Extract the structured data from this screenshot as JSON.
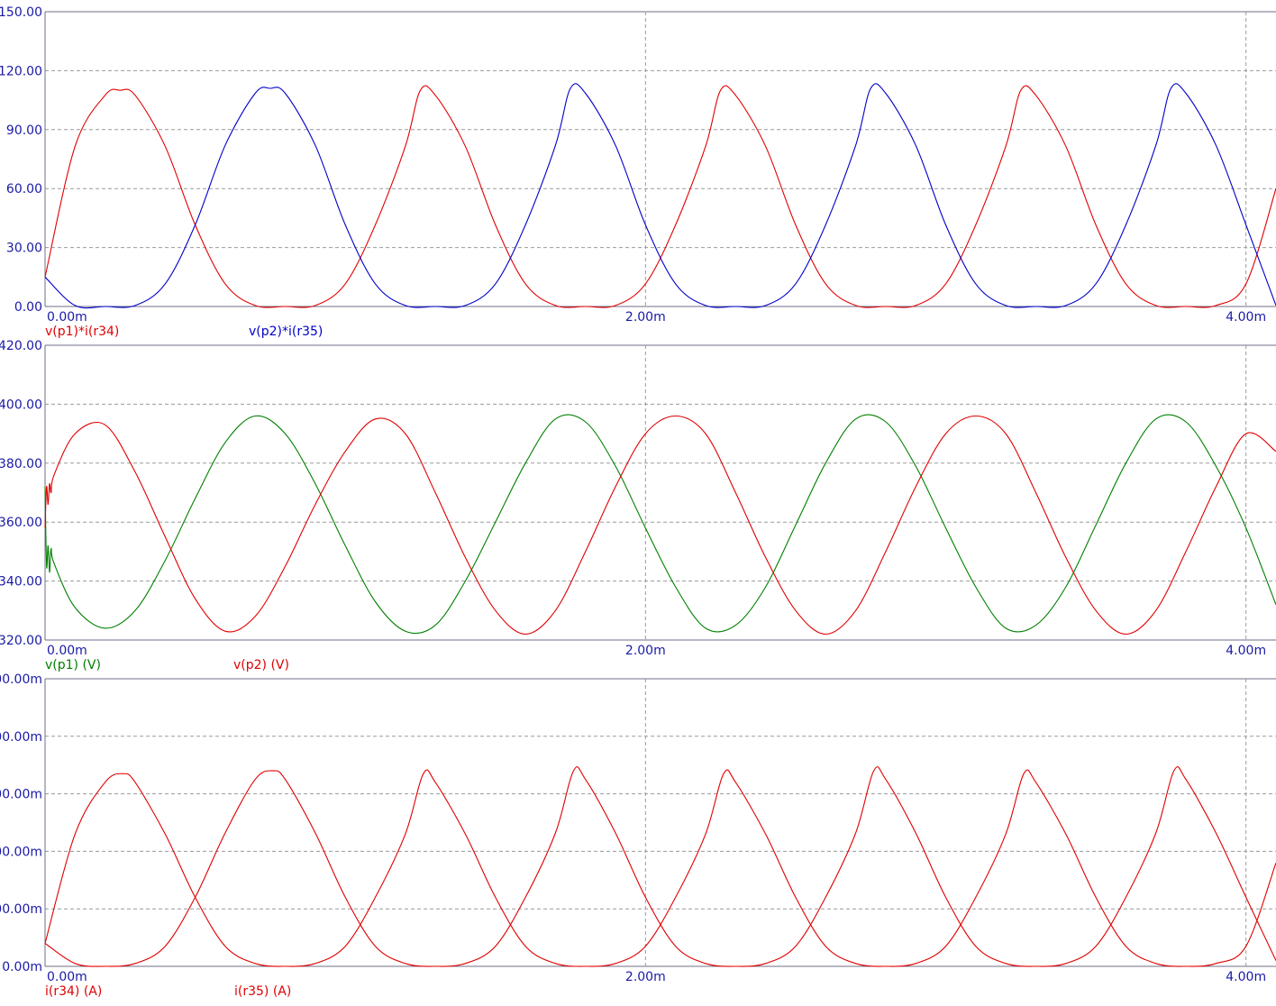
{
  "chart_data": [
    {
      "type": "line",
      "x_unit": "s",
      "xlim": [
        0,
        0.0041
      ],
      "ylim": [
        0,
        150
      ],
      "x_ticks": [
        {
          "value": 0,
          "label": "0.00m"
        },
        {
          "value": 0.002,
          "label": "2.00m"
        },
        {
          "value": 0.004,
          "label": "4.00m"
        }
      ],
      "y_ticks": [
        {
          "value": 0,
          "label": "0.00"
        },
        {
          "value": 30,
          "label": "30.00"
        },
        {
          "value": 60,
          "label": "60.00"
        },
        {
          "value": 90,
          "label": "90.00"
        },
        {
          "value": 120,
          "label": "120.00"
        },
        {
          "value": 150,
          "label": "150.00"
        }
      ],
      "series": [
        {
          "name": "v(p1)*i(r34)",
          "color": "#e00000",
          "x": [
            0,
            0.0001,
            0.0002,
            0.00025,
            0.0003,
            0.0004,
            0.0005,
            0.0006,
            0.0007,
            0.0008,
            0.0009,
            0.001,
            0.0011,
            0.0012,
            0.00125,
            0.0013,
            0.0014,
            0.0015,
            0.0016,
            0.0017,
            0.0018,
            0.0019,
            0.002,
            0.0021,
            0.0022,
            0.00225,
            0.0023,
            0.0024,
            0.0025,
            0.0026,
            0.0027,
            0.0028,
            0.0029,
            0.003,
            0.0031,
            0.0032,
            0.00325,
            0.0033,
            0.0034,
            0.0035,
            0.0036,
            0.0037,
            0.0038,
            0.0039,
            0.004,
            0.0041
          ],
          "y": [
            15,
            81.5,
            107.5,
            110,
            107.5,
            81.5,
            41.5,
            11.5,
            0.5,
            0,
            0.5,
            11.5,
            41.5,
            81.5,
            110,
            107.5,
            81.5,
            41.5,
            11.5,
            0.5,
            0,
            0.5,
            11.5,
            41.5,
            81.5,
            110,
            107.5,
            81.5,
            41.5,
            11.5,
            0.5,
            0,
            0.5,
            11.5,
            41.5,
            81.5,
            110,
            107.5,
            81.5,
            41.5,
            11.5,
            0.5,
            0,
            0.5,
            11.5,
            60
          ]
        },
        {
          "name": "v(p2)*i(r35)",
          "color": "#0000c8",
          "x": [
            0,
            0.0001,
            0.0002,
            0.0003,
            0.0004,
            0.0005,
            0.0006,
            0.0007,
            0.00075,
            0.0008,
            0.0009,
            0.001,
            0.0011,
            0.0012,
            0.0013,
            0.0014,
            0.0015,
            0.0016,
            0.0017,
            0.00175,
            0.0018,
            0.0019,
            0.002,
            0.0021,
            0.0022,
            0.0023,
            0.0024,
            0.0025,
            0.0026,
            0.0027,
            0.00275,
            0.0028,
            0.0029,
            0.003,
            0.0031,
            0.0032,
            0.0033,
            0.0034,
            0.0035,
            0.0036,
            0.0037,
            0.00375,
            0.0038,
            0.0039,
            0.004,
            0.0041
          ],
          "y": [
            15,
            0.5,
            0,
            0.5,
            11.5,
            41.5,
            82,
            108.5,
            111,
            108.5,
            82,
            41.5,
            11.5,
            0.5,
            0,
            0.5,
            11.5,
            41.5,
            82,
            111,
            108.5,
            82,
            41.5,
            11.5,
            0.5,
            0,
            0.5,
            11.5,
            41.5,
            82,
            111,
            108.5,
            82,
            41.5,
            11.5,
            0.5,
            0,
            0.5,
            11.5,
            41.5,
            82,
            111,
            108.5,
            82,
            41.5,
            0.5
          ]
        }
      ]
    },
    {
      "type": "line",
      "x_unit": "s",
      "xlim": [
        0,
        0.0041
      ],
      "ylim": [
        320,
        420
      ],
      "x_ticks": [
        {
          "value": 0,
          "label": "0.00m"
        },
        {
          "value": 0.002,
          "label": "2.00m"
        },
        {
          "value": 0.004,
          "label": "4.00m"
        }
      ],
      "y_ticks": [
        {
          "value": 320,
          "label": "320.00"
        },
        {
          "value": 340,
          "label": "340.00"
        },
        {
          "value": 360,
          "label": "360.00"
        },
        {
          "value": 380,
          "label": "380.00"
        },
        {
          "value": 400,
          "label": "400.00"
        },
        {
          "value": 420,
          "label": "420.00"
        }
      ],
      "series": [
        {
          "name": "v(p1) (V)",
          "color": "#008000",
          "x": [
            0,
            5e-06,
            1e-05,
            1.5e-05,
            2e-05,
            3e-05,
            0.0001,
            0.0002,
            0.0003,
            0.0004,
            0.0005,
            0.0006,
            0.0007,
            0.0008,
            0.0009,
            0.001,
            0.0011,
            0.0012,
            0.0013,
            0.0014,
            0.0015,
            0.0016,
            0.0017,
            0.0018,
            0.0019,
            0.002,
            0.0021,
            0.0022,
            0.0023,
            0.0024,
            0.0025,
            0.0026,
            0.0027,
            0.0028,
            0.0029,
            0.003,
            0.0031,
            0.0032,
            0.0033,
            0.0034,
            0.0035,
            0.0036,
            0.0037,
            0.0038,
            0.0039,
            0.004,
            0.0041
          ],
          "y": [
            372,
            345,
            352,
            343,
            351,
            346,
            331,
            324,
            330,
            347,
            368,
            387,
            396,
            390,
            373,
            352,
            333,
            323,
            325,
            340,
            360,
            380,
            395,
            394,
            379,
            358,
            338,
            324,
            325,
            338,
            359,
            380,
            395,
            394,
            379,
            358,
            338,
            324,
            325,
            338,
            359,
            380,
            395,
            394,
            379,
            358,
            332
          ]
        },
        {
          "name": "v(p2) (V)",
          "color": "#e00000",
          "x": [
            0,
            5e-06,
            1e-05,
            1.5e-05,
            2e-05,
            3e-05,
            0.0001,
            0.0002,
            0.0003,
            0.0004,
            0.0005,
            0.0006,
            0.0007,
            0.0008,
            0.0009,
            0.001,
            0.0011,
            0.0012,
            0.0013,
            0.0014,
            0.0015,
            0.0016,
            0.0017,
            0.0018,
            0.0019,
            0.002,
            0.0021,
            0.0022,
            0.0023,
            0.0024,
            0.0025,
            0.0026,
            0.0027,
            0.0028,
            0.0029,
            0.003,
            0.0031,
            0.0032,
            0.0033,
            0.0034,
            0.0035,
            0.0036,
            0.0037,
            0.0038,
            0.0039,
            0.004,
            0.0041
          ],
          "y": [
            358,
            372,
            366,
            373,
            370,
            376,
            390,
            393,
            377,
            355,
            334,
            323,
            328,
            345,
            366,
            384,
            395,
            390,
            370,
            348,
            330,
            322,
            330,
            350,
            372,
            390,
            396,
            390,
            370,
            348,
            330,
            322,
            330,
            350,
            372,
            390,
            396,
            390,
            370,
            348,
            330,
            322,
            330,
            350,
            372,
            390,
            384
          ]
        }
      ]
    },
    {
      "type": "line",
      "x_unit": "s",
      "xlim": [
        0,
        0.0041
      ],
      "ylim": [
        0,
        500
      ],
      "x_ticks": [
        {
          "value": 0,
          "label": "0.00m"
        },
        {
          "value": 0.002,
          "label": "2.00m"
        },
        {
          "value": 0.004,
          "label": "4.00m"
        }
      ],
      "y_ticks": [
        {
          "value": 0,
          "label": "0.00m"
        },
        {
          "value": 100,
          "label": "00.00m"
        },
        {
          "value": 200,
          "label": "00.00m"
        },
        {
          "value": 300,
          "label": "00.00m"
        },
        {
          "value": 400,
          "label": "00.00m"
        },
        {
          "value": 500,
          "label": "00.00m"
        }
      ],
      "series": [
        {
          "name": "i(r34) (A)",
          "color": "#e00000",
          "x": [
            0,
            0.0001,
            0.0002,
            0.00026,
            0.0003,
            0.0004,
            0.0005,
            0.0006,
            0.0007,
            0.0008,
            0.0009,
            0.001,
            0.0011,
            0.0012,
            0.00126,
            0.0013,
            0.0014,
            0.0015,
            0.0016,
            0.0017,
            0.0018,
            0.0019,
            0.002,
            0.0021,
            0.0022,
            0.00226,
            0.0023,
            0.0024,
            0.0025,
            0.0026,
            0.0027,
            0.0028,
            0.0029,
            0.003,
            0.0031,
            0.0032,
            0.00326,
            0.0033,
            0.0034,
            0.0035,
            0.0036,
            0.0037,
            0.0038,
            0.0039,
            0.004,
            0.0041
          ],
          "y": [
            40,
            230,
            320,
            335,
            320,
            230,
            120,
            35,
            5,
            0,
            5,
            35,
            120,
            230,
            335,
            320,
            230,
            120,
            35,
            5,
            0,
            5,
            35,
            120,
            230,
            335,
            320,
            230,
            120,
            35,
            5,
            0,
            5,
            35,
            120,
            230,
            335,
            320,
            230,
            120,
            35,
            5,
            0,
            5,
            35,
            180
          ]
        },
        {
          "name": "i(r35) (A)",
          "color": "#e00000",
          "x": [
            0,
            0.0001,
            0.0002,
            0.0003,
            0.0004,
            0.0005,
            0.0006,
            0.0007,
            0.00076,
            0.0008,
            0.0009,
            0.001,
            0.0011,
            0.0012,
            0.0013,
            0.0014,
            0.0015,
            0.0016,
            0.0017,
            0.00176,
            0.0018,
            0.0019,
            0.002,
            0.0021,
            0.0022,
            0.0023,
            0.0024,
            0.0025,
            0.0026,
            0.0027,
            0.00276,
            0.0028,
            0.0029,
            0.003,
            0.0031,
            0.0032,
            0.0033,
            0.0034,
            0.0035,
            0.0036,
            0.0037,
            0.00376,
            0.0038,
            0.0039,
            0.004,
            0.0041
          ],
          "y": [
            40,
            5,
            0,
            5,
            35,
            120,
            232,
            325,
            340,
            325,
            232,
            120,
            35,
            5,
            0,
            5,
            35,
            120,
            232,
            340,
            325,
            232,
            120,
            35,
            5,
            0,
            5,
            35,
            120,
            232,
            340,
            325,
            232,
            120,
            35,
            5,
            0,
            5,
            35,
            120,
            232,
            340,
            325,
            232,
            120,
            10
          ]
        }
      ]
    }
  ]
}
